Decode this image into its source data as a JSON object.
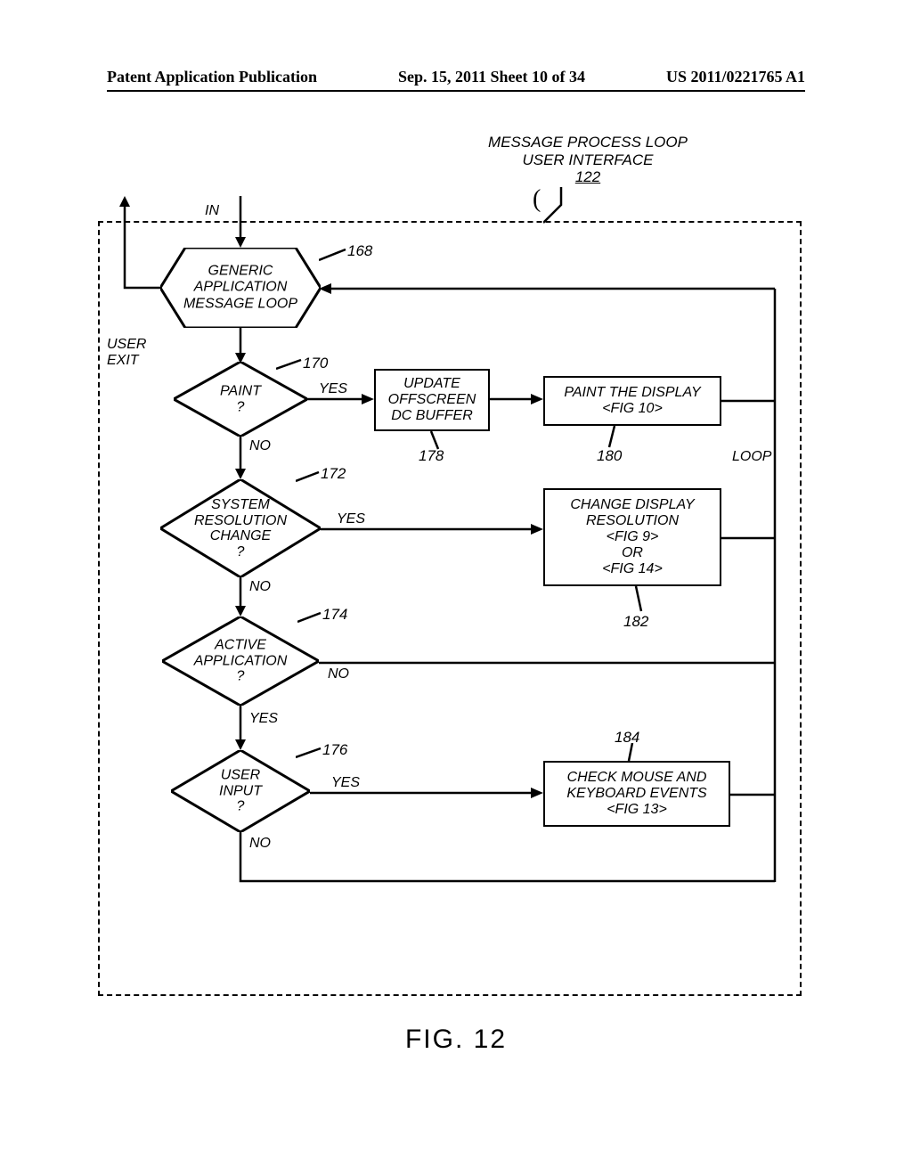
{
  "header": {
    "left": "Patent Application Publication",
    "center": "Sep. 15, 2011  Sheet 10 of 34",
    "right": "US 2011/0221765 A1"
  },
  "title": {
    "line1": "MESSAGE PROCESS LOOP",
    "line2": "USER INTERFACE",
    "ref": "122"
  },
  "nodes": {
    "in": "IN",
    "hex168": "GENERIC\nAPPLICATION\nMESSAGE LOOP",
    "user_exit": "USER\nEXIT",
    "d170": "PAINT\n?",
    "d172": "SYSTEM\nRESOLUTION\nCHANGE\n?",
    "d174": "ACTIVE\nAPPLICATION\n?",
    "d176": "USER\nINPUT\n?",
    "r178": "UPDATE\nOFFSCREEN\nDC BUFFER",
    "r180": "PAINT THE DISPLAY\n<FIG 10>",
    "r182": "CHANGE DISPLAY\nRESOLUTION\n<FIG 9>\nOR\n<FIG 14>",
    "r184": "CHECK MOUSE AND\nKEYBOARD EVENTS\n<FIG 13>"
  },
  "refs": {
    "r168": "168",
    "r170": "170",
    "r172": "172",
    "r174": "174",
    "r176": "176",
    "r178": "178",
    "r180": "180",
    "r182": "182",
    "r184": "184"
  },
  "edges": {
    "yes": "YES",
    "no": "NO",
    "loop": "LOOP"
  },
  "figure": "FIG.  12"
}
